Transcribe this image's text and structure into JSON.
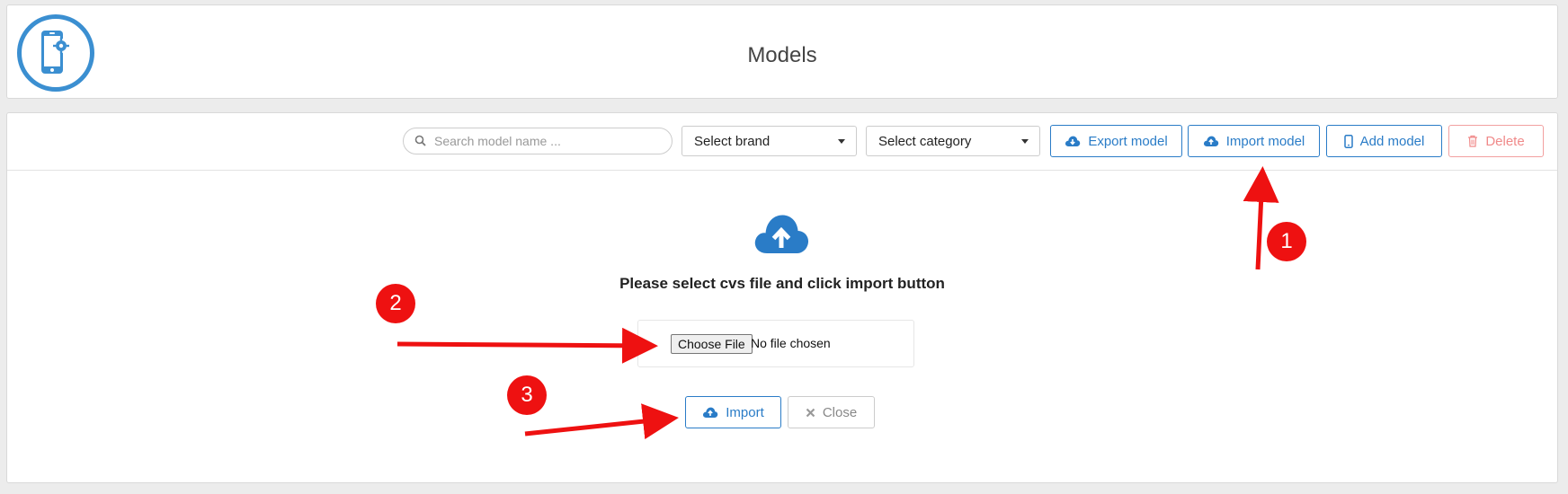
{
  "header": {
    "title": "Models",
    "logo_icon": "phone-settings-icon"
  },
  "toolbar": {
    "search_placeholder": "Search model name ...",
    "brand_select": "Select brand",
    "category_select": "Select category",
    "export_label": "Export model",
    "import_label": "Import model",
    "add_label": "Add model",
    "delete_label": "Delete"
  },
  "upload": {
    "instruction": "Please select cvs file and click import button",
    "choose_file_label": "Choose File",
    "no_file_text": "No file chosen",
    "import_label": "Import",
    "close_label": "Close"
  },
  "annotations": {
    "step1": "1",
    "step2": "2",
    "step3": "3"
  },
  "colors": {
    "accent": "#2a7cc7",
    "danger": "#f08a8a",
    "annotation": "#ee1111",
    "logo": "#3b8fd1"
  }
}
